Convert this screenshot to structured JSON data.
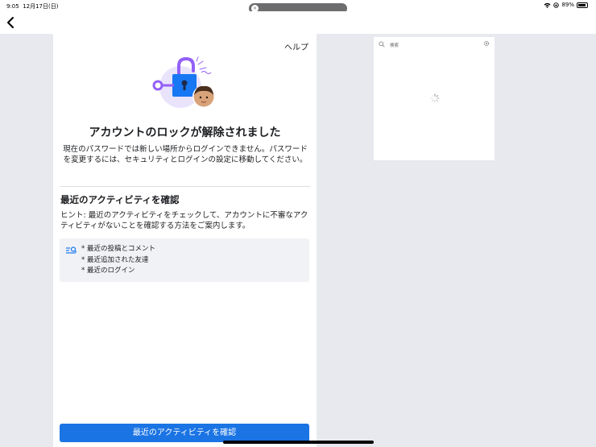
{
  "status_bar": {
    "time": "9:05",
    "date": "12月17日(日)",
    "battery": "89%"
  },
  "nav": {
    "back_icon": "chevron-left-icon"
  },
  "panel": {
    "help": "ヘルプ",
    "title": "アカウントのロックが解除されました",
    "description": "現在のパスワードでは新しい場所からログインできません。パスワードを変更するには、セキュリティとログインの設定に移動してください。",
    "section_title": "最近のアクティビティを確認",
    "hint": "ヒント: 最近のアクティビティをチェックして、アカウントに不審なアクティビティがないことを確認する方法をご案内します。",
    "activity_items": [
      "最近の投稿とコメント",
      "最近追加された友達",
      "最近のログイン"
    ],
    "cta_label": "最近のアクティビティを確認"
  },
  "preview": {
    "search_placeholder": "検索"
  },
  "colors": {
    "primary": "#1b74e4",
    "lock_purple": "#9360f7",
    "lock_blue": "#1877f2",
    "panel_bg": "#ffffff",
    "page_bg": "#e8e9ee"
  }
}
